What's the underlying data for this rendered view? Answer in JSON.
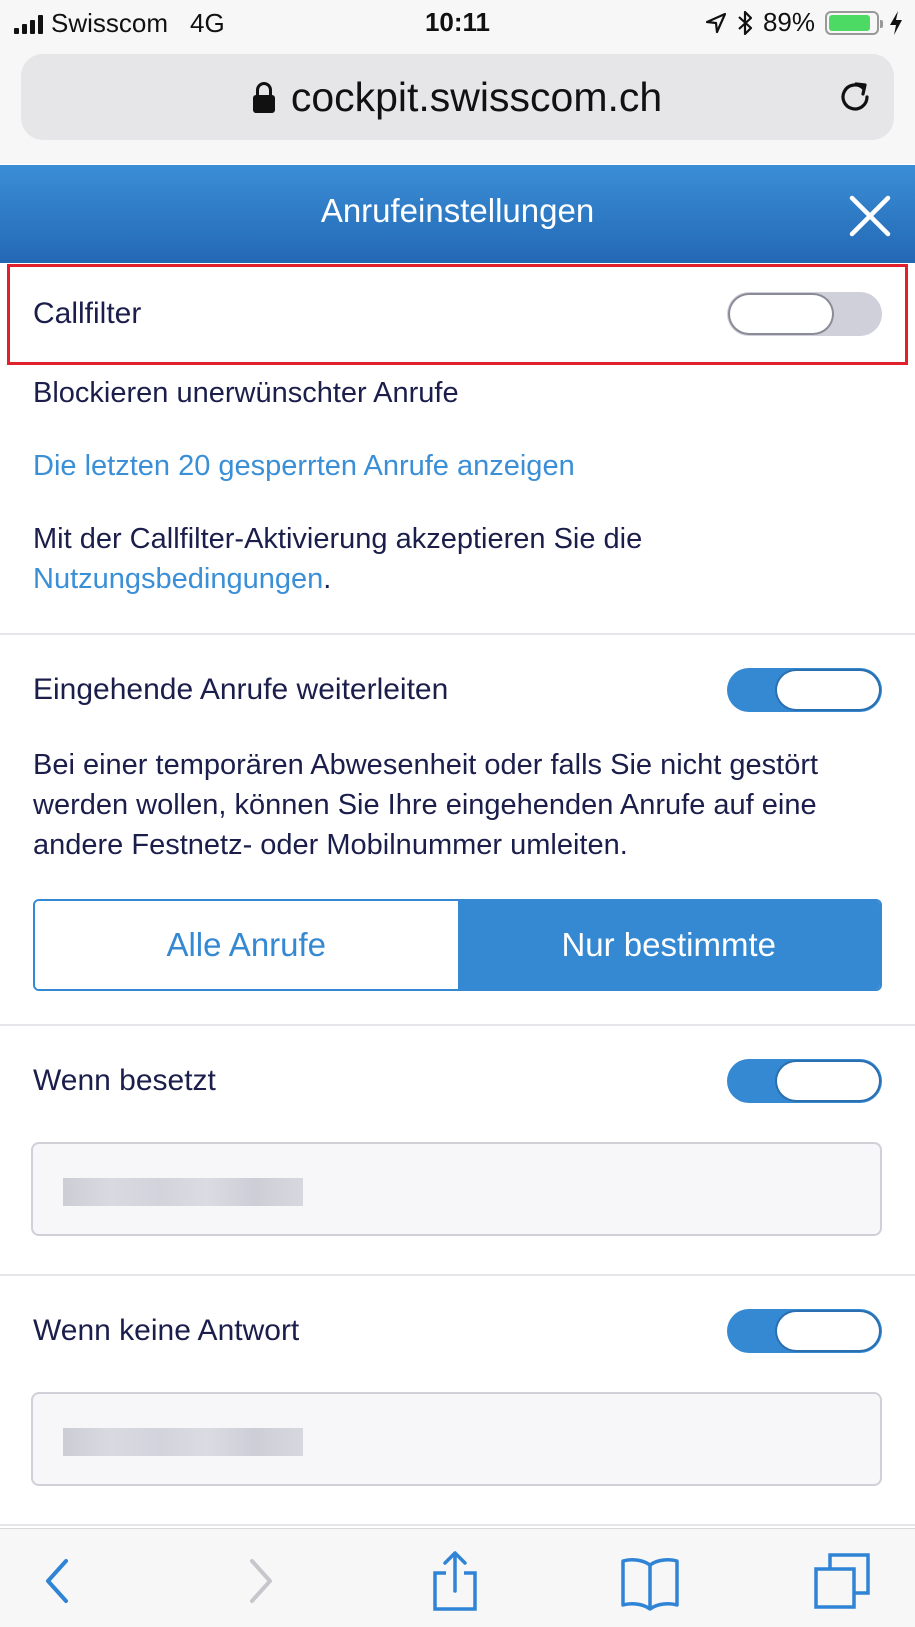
{
  "status_bar": {
    "carrier": "Swisscom",
    "network": "4G",
    "time": "10:11",
    "battery": "89%",
    "battery_level": 0.89,
    "icons": [
      "signal-icon",
      "location-icon",
      "bluetooth-icon",
      "battery-icon",
      "charging-icon"
    ]
  },
  "browser": {
    "url": "cockpit.swisscom.ch",
    "icons": [
      "lock-icon",
      "reload-icon"
    ]
  },
  "header": {
    "title": "Anrufeinstellungen"
  },
  "callfilter": {
    "label": "Callfilter",
    "enabled": false,
    "description": "Blockieren unerwünschter Anrufe",
    "blocked_link": "Die letzten 20 gesperrten Anrufe anzeigen",
    "terms_prefix": "Mit der Callfilter-Aktivierung akzeptieren Sie die ",
    "terms_link": "Nutzungsbedingungen",
    "terms_suffix": "."
  },
  "forwarding": {
    "label": "Eingehende Anrufe weiterleiten",
    "enabled": true,
    "description": "Bei einer temporären Abwesenheit oder falls Sie nicht gestört werden wollen, können Sie Ihre eingehenden Anrufe auf eine andere Festnetz- oder Mobilnummer umleiten.",
    "options": [
      "Alle Anrufe",
      "Nur bestimmte"
    ],
    "selected": "Nur bestimmte"
  },
  "when_busy": {
    "label": "Wenn besetzt",
    "enabled": true
  },
  "when_no_answer": {
    "label": "Wenn keine Antwort",
    "enabled": true
  },
  "toolbar": {
    "icons": [
      "back-icon",
      "forward-icon",
      "share-icon",
      "bookmarks-icon",
      "tabs-icon"
    ]
  },
  "colors": {
    "accent": "#3489d2",
    "header_top": "#3a8ed6",
    "header_bottom": "#2468b4",
    "highlight": "#e0202a",
    "text": "#1b1e4b"
  }
}
